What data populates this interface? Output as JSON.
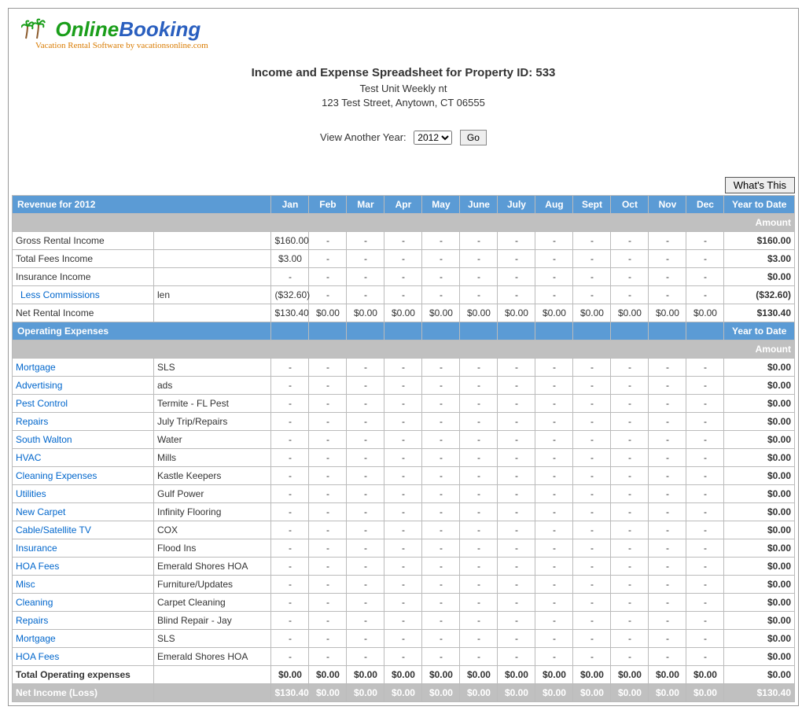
{
  "logo": {
    "brand_online": "Online",
    "brand_booking": "Booking",
    "tagline": "Vacation Rental Software by vacationsonline.com"
  },
  "header": {
    "title": "Income and Expense Spreadsheet for Property ID: 533",
    "unit": "Test Unit Weekly nt",
    "address": "123 Test Street, Anytown, CT 06555"
  },
  "yearSwitch": {
    "label": "View Another Year:",
    "value": "2012",
    "go": "Go"
  },
  "whatsThis": "What's This",
  "months": [
    "Jan",
    "Feb",
    "Mar",
    "Apr",
    "May",
    "June",
    "July",
    "Aug",
    "Sept",
    "Oct",
    "Nov",
    "Dec"
  ],
  "revenueHeader": "Revenue for 2012",
  "ytdHeader": "Year to Date",
  "amountLabel": "Amount",
  "revenueRows": [
    {
      "label": "Gross Rental Income",
      "vendor": "",
      "vals": [
        "$160.00",
        "-",
        "-",
        "-",
        "-",
        "-",
        "-",
        "-",
        "-",
        "-",
        "-",
        "-"
      ],
      "ytd": "$160.00",
      "link": false
    },
    {
      "label": "Total Fees Income",
      "vendor": "",
      "vals": [
        "$3.00",
        "-",
        "-",
        "-",
        "-",
        "-",
        "-",
        "-",
        "-",
        "-",
        "-",
        "-"
      ],
      "ytd": "$3.00",
      "link": false
    },
    {
      "label": "Insurance Income",
      "vendor": "",
      "vals": [
        "-",
        "-",
        "-",
        "-",
        "-",
        "-",
        "-",
        "-",
        "-",
        "-",
        "-",
        "-"
      ],
      "ytd": "$0.00",
      "link": false
    },
    {
      "label": "Less Commissions",
      "vendor": "len",
      "vals": [
        "($32.60)",
        "-",
        "-",
        "-",
        "-",
        "-",
        "-",
        "-",
        "-",
        "-",
        "-",
        "-"
      ],
      "ytd": "($32.60)",
      "link": true,
      "indent": true
    },
    {
      "label": "Net Rental Income",
      "vendor": "",
      "vals": [
        "$130.40",
        "$0.00",
        "$0.00",
        "$0.00",
        "$0.00",
        "$0.00",
        "$0.00",
        "$0.00",
        "$0.00",
        "$0.00",
        "$0.00",
        "$0.00"
      ],
      "ytd": "$130.40",
      "link": false
    }
  ],
  "expenseHeader": "Operating Expenses",
  "expenseRows": [
    {
      "label": "Mortgage",
      "vendor": "SLS",
      "vals": [
        "-",
        "-",
        "-",
        "-",
        "-",
        "-",
        "-",
        "-",
        "-",
        "-",
        "-",
        "-"
      ],
      "ytd": "$0.00"
    },
    {
      "label": "Advertising",
      "vendor": "ads",
      "vals": [
        "-",
        "-",
        "-",
        "-",
        "-",
        "-",
        "-",
        "-",
        "-",
        "-",
        "-",
        "-"
      ],
      "ytd": "$0.00"
    },
    {
      "label": "Pest Control",
      "vendor": "Termite - FL Pest",
      "vals": [
        "-",
        "-",
        "-",
        "-",
        "-",
        "-",
        "-",
        "-",
        "-",
        "-",
        "-",
        "-"
      ],
      "ytd": "$0.00"
    },
    {
      "label": "Repairs",
      "vendor": "July Trip/Repairs",
      "vals": [
        "-",
        "-",
        "-",
        "-",
        "-",
        "-",
        "-",
        "-",
        "-",
        "-",
        "-",
        "-"
      ],
      "ytd": "$0.00"
    },
    {
      "label": "South Walton",
      "vendor": "Water",
      "vals": [
        "-",
        "-",
        "-",
        "-",
        "-",
        "-",
        "-",
        "-",
        "-",
        "-",
        "-",
        "-"
      ],
      "ytd": "$0.00"
    },
    {
      "label": "HVAC",
      "vendor": "Mills",
      "vals": [
        "-",
        "-",
        "-",
        "-",
        "-",
        "-",
        "-",
        "-",
        "-",
        "-",
        "-",
        "-"
      ],
      "ytd": "$0.00"
    },
    {
      "label": "Cleaning Expenses",
      "vendor": "Kastle Keepers",
      "vals": [
        "-",
        "-",
        "-",
        "-",
        "-",
        "-",
        "-",
        "-",
        "-",
        "-",
        "-",
        "-"
      ],
      "ytd": "$0.00"
    },
    {
      "label": "Utilities",
      "vendor": "Gulf Power",
      "vals": [
        "-",
        "-",
        "-",
        "-",
        "-",
        "-",
        "-",
        "-",
        "-",
        "-",
        "-",
        "-"
      ],
      "ytd": "$0.00"
    },
    {
      "label": "New Carpet",
      "vendor": "Infinity Flooring",
      "vals": [
        "-",
        "-",
        "-",
        "-",
        "-",
        "-",
        "-",
        "-",
        "-",
        "-",
        "-",
        "-"
      ],
      "ytd": "$0.00"
    },
    {
      "label": "Cable/Satellite TV",
      "vendor": "COX",
      "vals": [
        "-",
        "-",
        "-",
        "-",
        "-",
        "-",
        "-",
        "-",
        "-",
        "-",
        "-",
        "-"
      ],
      "ytd": "$0.00"
    },
    {
      "label": "Insurance",
      "vendor": "Flood Ins",
      "vals": [
        "-",
        "-",
        "-",
        "-",
        "-",
        "-",
        "-",
        "-",
        "-",
        "-",
        "-",
        "-"
      ],
      "ytd": "$0.00"
    },
    {
      "label": "HOA Fees",
      "vendor": "Emerald Shores HOA",
      "vals": [
        "-",
        "-",
        "-",
        "-",
        "-",
        "-",
        "-",
        "-",
        "-",
        "-",
        "-",
        "-"
      ],
      "ytd": "$0.00"
    },
    {
      "label": "Misc",
      "vendor": "Furniture/Updates",
      "vals": [
        "-",
        "-",
        "-",
        "-",
        "-",
        "-",
        "-",
        "-",
        "-",
        "-",
        "-",
        "-"
      ],
      "ytd": "$0.00"
    },
    {
      "label": "Cleaning",
      "vendor": "Carpet Cleaning",
      "vals": [
        "-",
        "-",
        "-",
        "-",
        "-",
        "-",
        "-",
        "-",
        "-",
        "-",
        "-",
        "-"
      ],
      "ytd": "$0.00"
    },
    {
      "label": "Repairs",
      "vendor": "Blind Repair - Jay",
      "vals": [
        "-",
        "-",
        "-",
        "-",
        "-",
        "-",
        "-",
        "-",
        "-",
        "-",
        "-",
        "-"
      ],
      "ytd": "$0.00"
    },
    {
      "label": "Mortgage",
      "vendor": "SLS",
      "vals": [
        "-",
        "-",
        "-",
        "-",
        "-",
        "-",
        "-",
        "-",
        "-",
        "-",
        "-",
        "-"
      ],
      "ytd": "$0.00"
    },
    {
      "label": "HOA Fees",
      "vendor": "Emerald Shores HOA",
      "vals": [
        "-",
        "-",
        "-",
        "-",
        "-",
        "-",
        "-",
        "-",
        "-",
        "-",
        "-",
        "-"
      ],
      "ytd": "$0.00"
    }
  ],
  "totalExpenses": {
    "label": "Total Operating expenses",
    "vals": [
      "$0.00",
      "$0.00",
      "$0.00",
      "$0.00",
      "$0.00",
      "$0.00",
      "$0.00",
      "$0.00",
      "$0.00",
      "$0.00",
      "$0.00",
      "$0.00"
    ],
    "ytd": "$0.00"
  },
  "netIncome": {
    "label": "Net Income (Loss)",
    "vals": [
      "$130.40",
      "$0.00",
      "$0.00",
      "$0.00",
      "$0.00",
      "$0.00",
      "$0.00",
      "$0.00",
      "$0.00",
      "$0.00",
      "$0.00",
      "$0.00"
    ],
    "ytd": "$130.40"
  }
}
